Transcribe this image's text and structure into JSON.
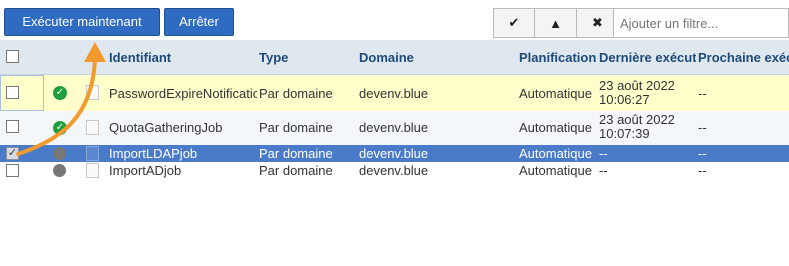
{
  "toolbar": {
    "run_now_label": "Exécuter maintenant",
    "stop_label": "Arrêter",
    "filter_placeholder": "Ajouter un filtre..."
  },
  "filter_buttons": [
    {
      "icon": "check-icon",
      "glyph": "✔"
    },
    {
      "icon": "warning-icon",
      "glyph": "▲"
    },
    {
      "icon": "close-icon",
      "glyph": "✖"
    }
  ],
  "columns": {
    "identifier": "Identifiant",
    "type": "Type",
    "domain": "Domaine",
    "schedule": "Planification",
    "last_run": "Dernière exécution",
    "next_run": "Prochaine exécution"
  },
  "rows": [
    {
      "status": "success",
      "id": "PasswordExpireNotification",
      "type": "Par domaine",
      "domain": "devenv.blue",
      "schedule": "Automatique",
      "last_run_date": "23 août 2022",
      "last_run_time": "10:06:27",
      "next_run": "--"
    },
    {
      "status": "success",
      "id": "QuotaGatheringJob",
      "type": "Par domaine",
      "domain": "devenv.blue",
      "schedule": "Automatique",
      "last_run_date": "23 août 2022",
      "last_run_time": "10:07:39",
      "next_run": "--"
    },
    {
      "status": "idle",
      "id": "ImportLDAPjob",
      "type": "Par domaine",
      "domain": "devenv.blue",
      "schedule": "Automatique",
      "last_run_date": "--",
      "last_run_time": "",
      "next_run": "--",
      "selected": true
    },
    {
      "status": "idle",
      "id": "ImportADjob",
      "type": "Par domaine",
      "domain": "devenv.blue",
      "schedule": "Automatique",
      "last_run_date": "--",
      "last_run_time": "",
      "next_run": "--"
    }
  ],
  "colors": {
    "primary_button": "#2f6bc1",
    "selected_row": "#4a7bc8",
    "warning_row": "#ffffcc",
    "annotation_arrow": "#f39a2e"
  }
}
